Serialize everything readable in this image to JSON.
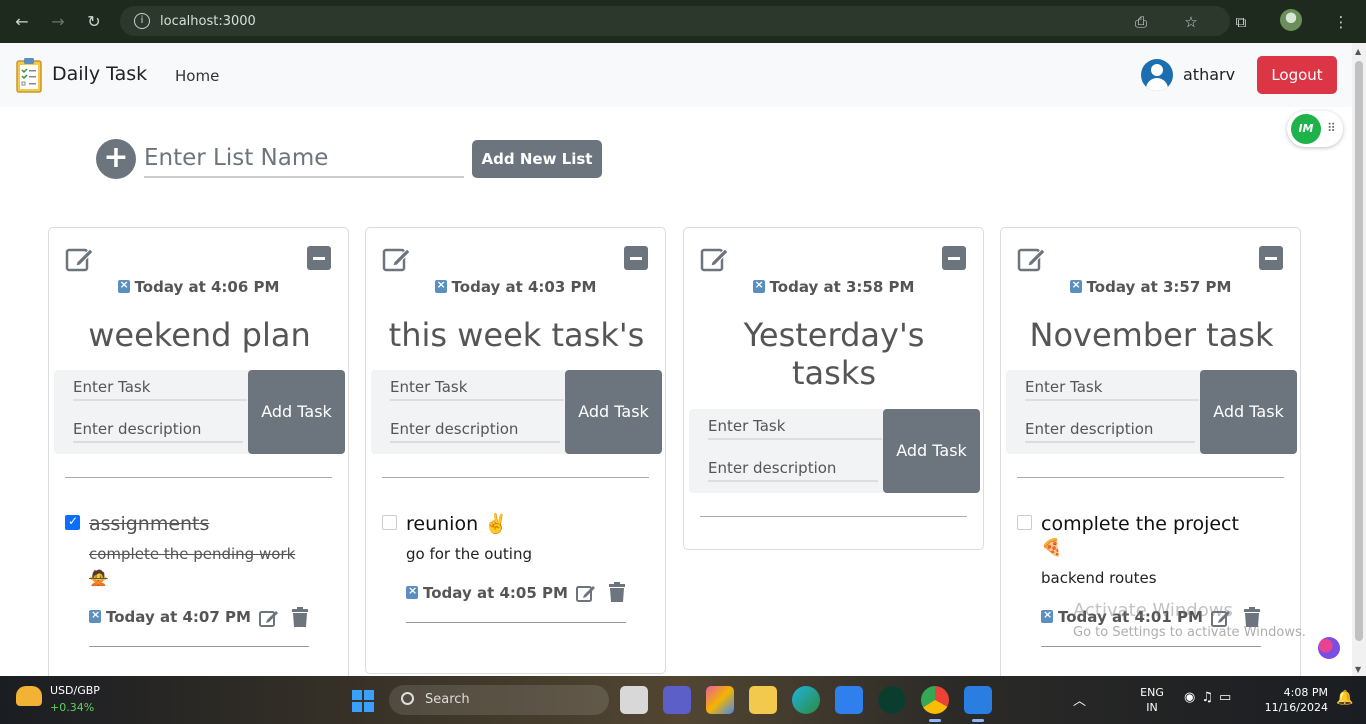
{
  "browser": {
    "url": "localhost:3000"
  },
  "nav": {
    "brand": "Daily Task",
    "home": "Home",
    "username": "atharv",
    "logout": "Logout"
  },
  "widget": {
    "im_label": "IM"
  },
  "add_list": {
    "placeholder": "Enter List Name",
    "button": "Add New List"
  },
  "cards": [
    {
      "date": "Today at 4:06 PM",
      "title": "weekend plan",
      "task_placeholder": "Enter Task",
      "desc_placeholder": "Enter description",
      "add_task": "Add Task",
      "tasks": [
        {
          "name": "assignments",
          "description": "complete the pending work",
          "emoji": "🙅",
          "date": "Today at 4:07 PM",
          "done": true
        }
      ]
    },
    {
      "date": "Today at 4:03 PM",
      "title": "this week task's",
      "task_placeholder": "Enter Task",
      "desc_placeholder": "Enter description",
      "add_task": "Add Task",
      "tasks": [
        {
          "name": "reunion ✌️",
          "description": "go for the outing",
          "date": "Today at 4:05 PM",
          "done": false
        }
      ]
    },
    {
      "date": "Today at 3:58 PM",
      "title": "Yesterday's tasks",
      "task_placeholder": "Enter Task",
      "desc_placeholder": "Enter description",
      "add_task": "Add Task",
      "tasks": []
    },
    {
      "date": "Today at 3:57 PM",
      "title": "November task",
      "task_placeholder": "Enter Task",
      "desc_placeholder": "Enter description",
      "add_task": "Add Task",
      "tasks": [
        {
          "name": "complete the project",
          "emoji": "🍕",
          "description": "backend routes",
          "date": "Today at 4:01 PM",
          "done": false
        }
      ]
    }
  ],
  "watermark": {
    "line1": "Activate Windows",
    "line2": "Go to Settings to activate Windows."
  },
  "taskbar": {
    "stock_name": "USD/GBP",
    "stock_change": "+0.34%",
    "search": "Search",
    "lang_1": "ENG",
    "lang_2": "IN",
    "time": "4:08 PM",
    "date": "11/16/2024"
  },
  "colors": {
    "logout": "#dc3545",
    "secondary": "#6c757d",
    "checkbox": "#0d6efd",
    "im_green": "#1db24a"
  }
}
